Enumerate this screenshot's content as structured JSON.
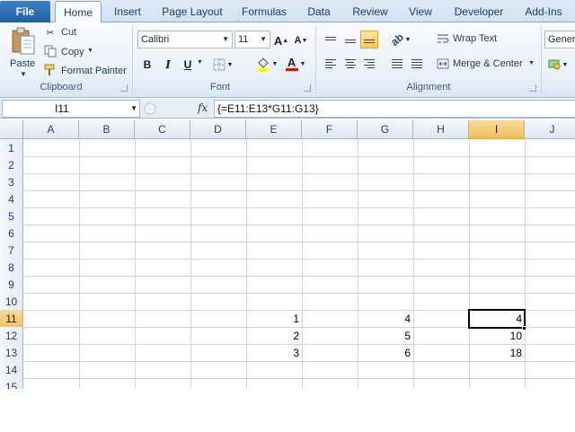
{
  "ribbon": {
    "file_tab": "File",
    "tabs": [
      "Home",
      "Insert",
      "Page Layout",
      "Formulas",
      "Data",
      "Review",
      "View",
      "Developer",
      "Add-Ins"
    ],
    "active_tab": "Home",
    "clipboard": {
      "paste": "Paste",
      "cut": "Cut",
      "copy": "Copy",
      "format_painter": "Format Painter",
      "label": "Clipboard"
    },
    "font": {
      "name": "Calibri",
      "size": "11",
      "bold": "B",
      "italic": "I",
      "underline": "U",
      "grow": "A",
      "shrink": "A",
      "font_color_letter": "A",
      "label": "Font"
    },
    "alignment": {
      "wrap_text": "Wrap Text",
      "merge_center": "Merge & Center",
      "label": "Alignment"
    },
    "number": {
      "format": "Genera"
    }
  },
  "formula_bar": {
    "name_box": "I11",
    "fx": "fx",
    "formula": "{=E11:E13*G11:G13}"
  },
  "grid": {
    "columns": [
      "A",
      "B",
      "C",
      "D",
      "E",
      "F",
      "G",
      "H",
      "I",
      "J"
    ],
    "rows": [
      "1",
      "2",
      "3",
      "4",
      "5",
      "6",
      "7",
      "8",
      "9",
      "10",
      "11",
      "12",
      "13",
      "14",
      "15"
    ],
    "selected_column": "I",
    "selected_row": "11",
    "cells": {
      "E11": "1",
      "E12": "2",
      "E13": "3",
      "G11": "4",
      "G12": "5",
      "G13": "6",
      "I11": "4",
      "I12": "10",
      "I13": "18"
    }
  },
  "colors": {
    "file_tab": "#2a6ab4",
    "selection_header": "#f1c15f",
    "grid_line": "#d4d4d4"
  }
}
